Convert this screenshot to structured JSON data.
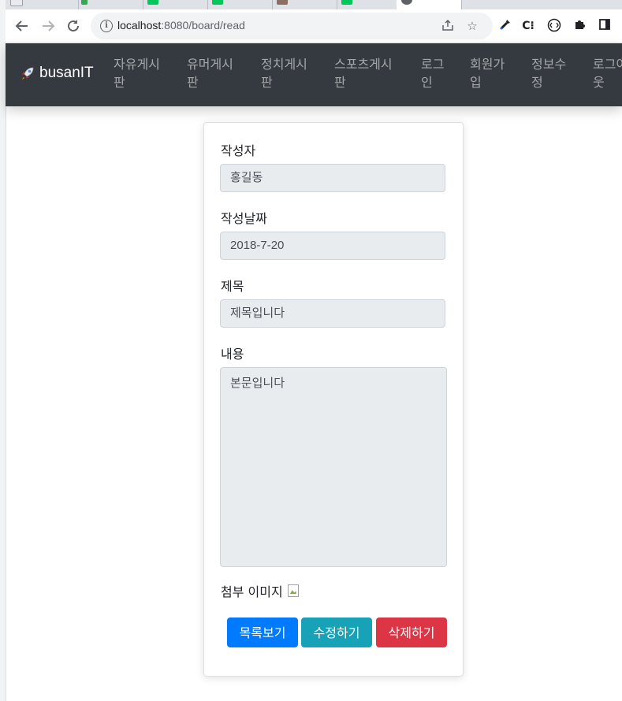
{
  "browser": {
    "url_host": "localhost",
    "url_rest": ":8080/board/read"
  },
  "navbar": {
    "brand": "busanIT",
    "items": [
      {
        "line1": "자유게시",
        "line2": "판"
      },
      {
        "line1": "유머게시",
        "line2": "판"
      },
      {
        "line1": "정치게시",
        "line2": "판"
      },
      {
        "line1": "스포츠게시",
        "line2": "판"
      },
      {
        "line1": "로그",
        "line2": "인"
      },
      {
        "line1": "회원가",
        "line2": "입"
      },
      {
        "line1": "정보수",
        "line2": "정"
      },
      {
        "line1": "로그아",
        "line2": "웃"
      }
    ]
  },
  "form": {
    "writer_label": "작성자",
    "writer_value": "홍길동",
    "date_label": "작성날짜",
    "date_value": "2018-7-20",
    "title_label": "제목",
    "title_value": "제목입니다",
    "content_label": "내용",
    "content_value": "본문입니다",
    "attach_label": "첨부 이미지"
  },
  "buttons": {
    "list": "목록보기",
    "edit": "수정하기",
    "delete": "삭제하기"
  },
  "colors": {
    "navbar_bg": "#343a40",
    "primary": "#007bff",
    "info": "#17a2b8",
    "danger": "#dc3545"
  }
}
